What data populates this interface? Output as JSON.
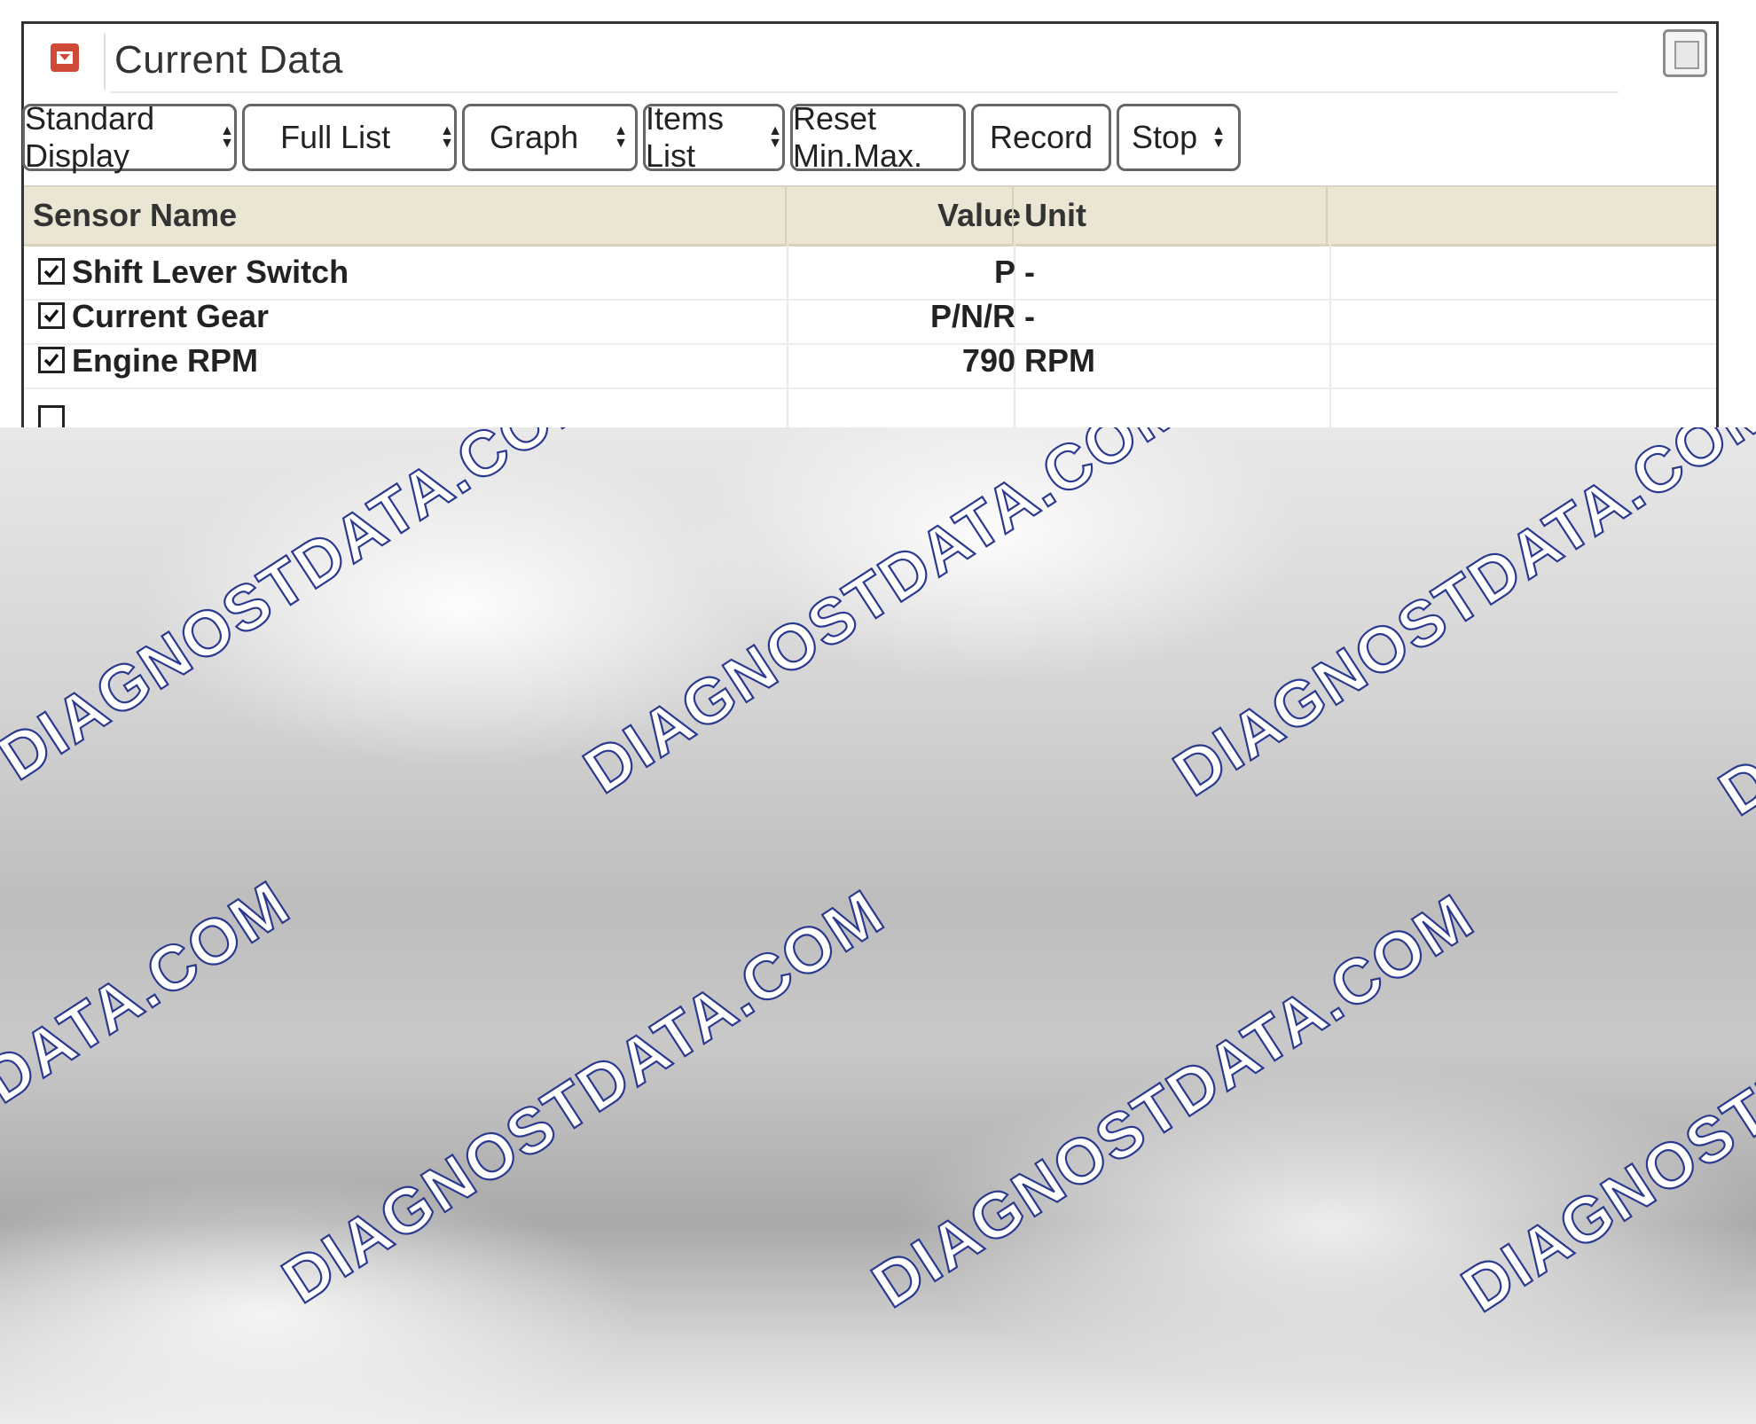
{
  "window": {
    "title": "Current Data"
  },
  "toolbar": {
    "buttons": [
      {
        "label": "Standard Display",
        "dropdown": true
      },
      {
        "label": "Full List",
        "dropdown": true
      },
      {
        "label": "Graph",
        "dropdown": true
      },
      {
        "label": "Items List",
        "dropdown": true
      },
      {
        "label": "Reset Min.Max.",
        "dropdown": false
      },
      {
        "label": "Record",
        "dropdown": false
      },
      {
        "label": "Stop",
        "dropdown": true
      }
    ]
  },
  "table": {
    "headers": {
      "sensor_name": "Sensor Name",
      "value": "Value",
      "unit": "Unit"
    },
    "rows": [
      {
        "checked": true,
        "name": "Shift Lever Switch",
        "value": "P",
        "unit": "-"
      },
      {
        "checked": true,
        "name": "Current Gear",
        "value": "P/N/R",
        "unit": "-"
      },
      {
        "checked": true,
        "name": "Engine RPM",
        "value": "790",
        "unit": "RPM"
      }
    ]
  },
  "watermark": {
    "text": "DIAGNOSTDATA.COM"
  },
  "colors": {
    "header_bg": "#ebe6d3",
    "collapse_icon": "#d04a38",
    "watermark_outline": "#2b3a8f"
  }
}
